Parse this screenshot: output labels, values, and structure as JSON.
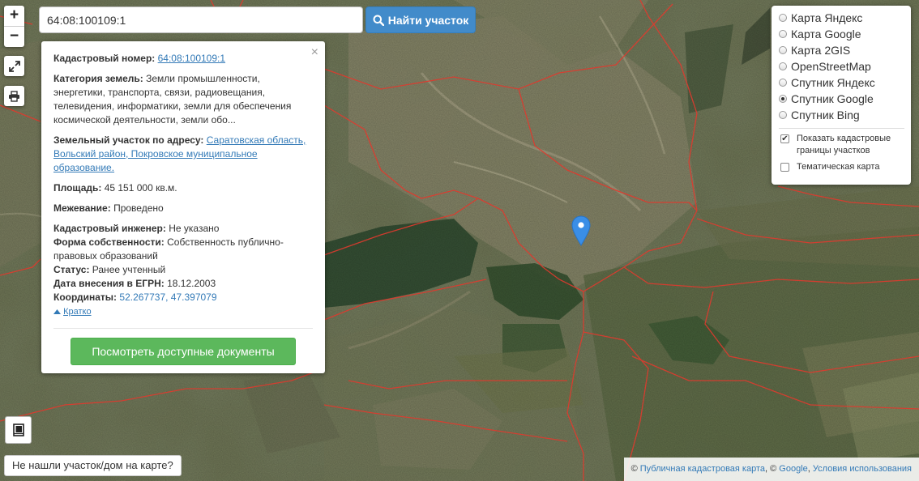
{
  "search": {
    "value": "64:08:100109:1",
    "button_label": "Найти участок"
  },
  "zoom": {
    "in_label": "+",
    "out_label": "−"
  },
  "popup": {
    "close_label": "×",
    "cadastral_number_label": "Кадастровый номер:",
    "cadastral_number_value": "64:08:100109:1",
    "land_category_label": "Категория земель:",
    "land_category_value": "Земли промышленности, энергетики, транспорта, связи, радиовещания, телевидения, информатики, земли для обеспечения космической деятельности, земли обо...",
    "address_label": "Земельный участок по адресу:",
    "address_value": "Саратовская область, Вольский район, Покровское муниципальное образование.",
    "area_label": "Площадь:",
    "area_value": "45 151 000 кв.м.",
    "survey_label": "Межевание:",
    "survey_value": "Проведено",
    "engineer_label": "Кадастровый инженер:",
    "engineer_value": "Не указано",
    "ownership_label": "Форма собственности:",
    "ownership_value": "Собственность публично-правовых образований",
    "status_label": "Статус:",
    "status_value": "Ранее учтенный",
    "egrn_date_label": "Дата внесения в ЕГРН:",
    "egrn_date_value": "18.12.2003",
    "coords_label": "Координаты:",
    "coords_value": "52.267737, 47.397079",
    "short_link": "Кратко",
    "docs_button": "Посмотреть доступные документы"
  },
  "layers": {
    "base_options": [
      {
        "label": "Карта Яндекс",
        "selected": false
      },
      {
        "label": "Карта Google",
        "selected": false
      },
      {
        "label": "Карта 2GIS",
        "selected": false
      },
      {
        "label": "OpenStreetMap",
        "selected": false
      },
      {
        "label": "Спутник Яндекс",
        "selected": false
      },
      {
        "label": "Спутник Google",
        "selected": true
      },
      {
        "label": "Спутник Bing",
        "selected": false
      }
    ],
    "overlay_options": [
      {
        "label": "Показать кадастровые границы участков",
        "checked": true
      },
      {
        "label": "Тематическая карта",
        "checked": false
      }
    ]
  },
  "bottom": {
    "not_found_label": "Не нашли участок/дом на карте?"
  },
  "attribution": {
    "copyright1": "©",
    "link1": "Публичная кадастровая карта",
    "sep": ", ©",
    "link2": "Google",
    "link3": "Условия использования"
  },
  "colors": {
    "search_button": "#428bca",
    "docs_button": "#5cb85c",
    "marker": "#3a8ee6",
    "parcel_border": "#e03a2e"
  }
}
